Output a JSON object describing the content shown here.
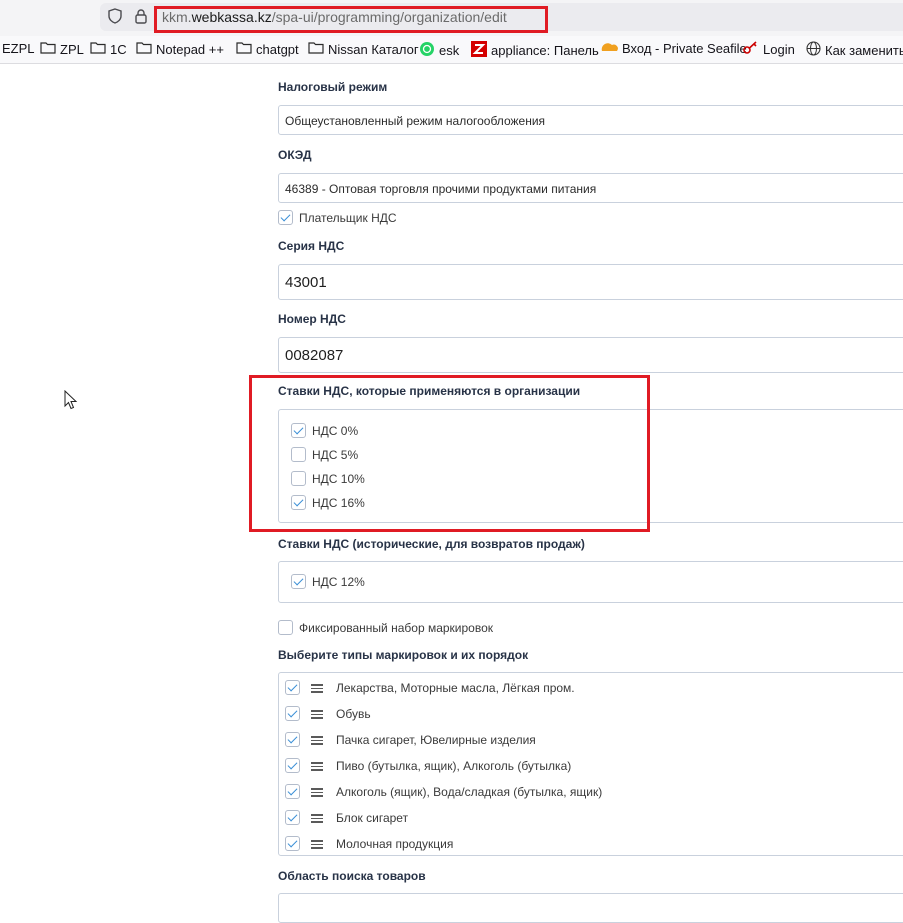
{
  "browser": {
    "url_host": "kkm.webkassa.kz",
    "url_path": "/spa-ui/programming/organization/edit",
    "url_prefix": "kkm.",
    "url_host_main": "webkassa.kz",
    "bookmarks": [
      {
        "label": "EZPL",
        "icon": "folder-icon"
      },
      {
        "label": "ZPL",
        "icon": "folder-icon"
      },
      {
        "label": "1C",
        "icon": "folder-icon"
      },
      {
        "label": "Notepad ++",
        "icon": "folder-icon"
      },
      {
        "label": "chatgpt",
        "icon": "folder-icon"
      },
      {
        "label": "Nissan Каталог",
        "icon": "folder-icon"
      },
      {
        "label": "esk",
        "icon": "whatsapp-icon"
      },
      {
        "label": "appliance: Панель",
        "icon": "zabbix-icon"
      },
      {
        "label": "Вход - Private Seafile",
        "icon": "seafile-icon"
      },
      {
        "label": "Login",
        "icon": "key-icon"
      },
      {
        "label": "Как заменить в",
        "icon": "globe-icon"
      }
    ]
  },
  "form": {
    "tax_regime": {
      "label": "Налоговый режим",
      "value": "Общеустановленный режим налогообложения"
    },
    "okved": {
      "label": "ОКЭД",
      "value": "46389 - Оптовая торговля прочими продуктами питания"
    },
    "vat_payer": {
      "label": "Плательщик НДС",
      "checked": true
    },
    "vat_series": {
      "label": "Серия НДС",
      "value": "43001"
    },
    "vat_number": {
      "label": "Номер НДС",
      "value": "0082087"
    },
    "vat_rates": {
      "label": "Ставки НДС, которые применяются в организации",
      "options": [
        {
          "label": "НДС 0%",
          "checked": true
        },
        {
          "label": "НДС 5%",
          "checked": false
        },
        {
          "label": "НДС 10%",
          "checked": false
        },
        {
          "label": "НДС 16%",
          "checked": true
        }
      ]
    },
    "vat_historic": {
      "label": "Ставки НДС (исторические, для возвратов продаж)",
      "options": [
        {
          "label": "НДС 12%",
          "checked": true
        }
      ]
    },
    "fixed_markings": {
      "label": "Фиксированный набор маркировок",
      "checked": false
    },
    "marking_types": {
      "label": "Выберите типы маркировок и их порядок",
      "items": [
        {
          "label": "Лекарства, Моторные масла, Лёгкая пром.",
          "checked": true
        },
        {
          "label": "Обувь",
          "checked": true
        },
        {
          "label": "Пачка сигарет, Ювелирные изделия",
          "checked": true
        },
        {
          "label": "Пиво (бутылка, ящик), Алкоголь (бутылка)",
          "checked": true
        },
        {
          "label": "Алкоголь (ящик), Вода/сладкая (бутылка, ящик)",
          "checked": true
        },
        {
          "label": "Блок сигарет",
          "checked": true
        },
        {
          "label": "Молочная продукция",
          "checked": true
        }
      ]
    },
    "search_area": {
      "label": "Область поиска товаров"
    }
  },
  "colors": {
    "highlight": "#e01b24",
    "check": "#3a8fd6"
  }
}
